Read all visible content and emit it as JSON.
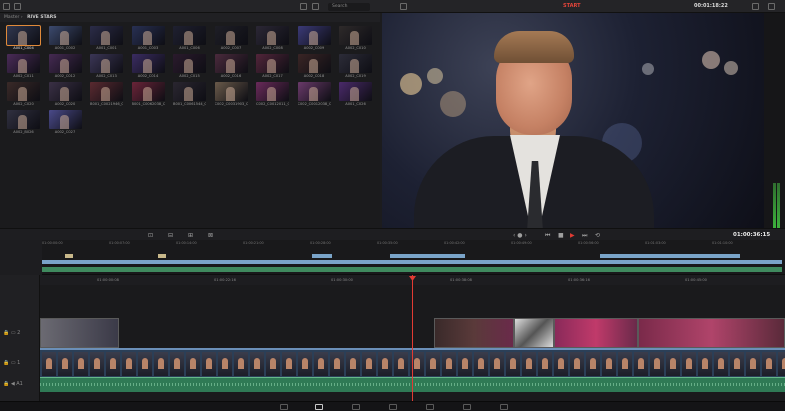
{
  "topbar": {
    "search_label": "Search",
    "viewer_label": "START",
    "timecode": "00:01:18:22"
  },
  "media_pool": {
    "crumb_root": "Master",
    "crumb_bin": "RIVE STARS",
    "clips": [
      {
        "label": "A001_C004",
        "color": "#30374f",
        "selected": true
      },
      {
        "label": "A001_C002",
        "color": "#3c4a6e"
      },
      {
        "label": "A001_C001",
        "color": "#2b2c48"
      },
      {
        "label": "A001_C003",
        "color": "#283053"
      },
      {
        "label": "A001_C006",
        "color": "#1f2030"
      },
      {
        "label": "A002_C007",
        "color": "#1e1e26"
      },
      {
        "label": "A002_C008",
        "color": "#2b2735"
      },
      {
        "label": "A002_C009",
        "color": "#3b3a78"
      },
      {
        "label": "A002_C010",
        "color": "#2e2a2a"
      },
      {
        "label": "A002_C011",
        "color": "#4a2b58"
      },
      {
        "label": "A002_C012",
        "color": "#452a52"
      },
      {
        "label": "A002_C013",
        "color": "#3b3656"
      },
      {
        "label": "A002_C014",
        "color": "#3a2c62"
      },
      {
        "label": "A002_C015",
        "color": "#2a1a2c"
      },
      {
        "label": "A002_C016",
        "color": "#4a2a3c"
      },
      {
        "label": "A002_C017",
        "color": "#52253a"
      },
      {
        "label": "A002_C018",
        "color": "#3a2525"
      },
      {
        "label": "A002_C019",
        "color": "#2c2c38"
      },
      {
        "label": "A002_C020",
        "color": "#3a2a28"
      },
      {
        "label": "A002_C020",
        "color": "#3a3045"
      },
      {
        "label": "B001_C0021946_C...",
        "color": "#5a2a30"
      },
      {
        "label": "B001_C0062038_C...",
        "color": "#6a2438"
      },
      {
        "label": "B001_C0061544_C...",
        "color": "#2a2630"
      },
      {
        "label": "C002_C0031903_C...",
        "color": "#6a5a4a"
      },
      {
        "label": "C002_C0012011_C...",
        "color": "#6a2a5a"
      },
      {
        "label": "C002_C0012038_C...",
        "color": "#6a3a6a"
      },
      {
        "label": "A001_C026",
        "color": "#4a2a6a"
      },
      {
        "label": "A002_B026",
        "color": "#303040"
      },
      {
        "label": "A002_C027",
        "color": "#4a4a8a"
      }
    ]
  },
  "transport": {
    "timecode": "01:00:36:15"
  },
  "mini_timeline": {
    "ticks": [
      "01:00:00:00",
      "01:00:07:00",
      "01:00:14:00",
      "01:00:21:00",
      "01:00:28:00",
      "01:00:35:00",
      "01:00:42:00",
      "01:00:49:00",
      "01:00:56:00",
      "01:01:03:00",
      "01:01:10:00"
    ]
  },
  "timeline": {
    "ticks": [
      "01:00:00:08",
      "01:00:22:16",
      "01:00:30:00",
      "01:00:38:08",
      "01:00:36:16",
      "01:00:45:00"
    ],
    "tracks": {
      "v2": "2",
      "v1": "1",
      "a1": "A1"
    }
  },
  "colors": {
    "accent": "#e08a3a",
    "playhead": "#e23b33",
    "video_clip": "#6b8fb8",
    "audio_clip": "#2f7a55"
  }
}
